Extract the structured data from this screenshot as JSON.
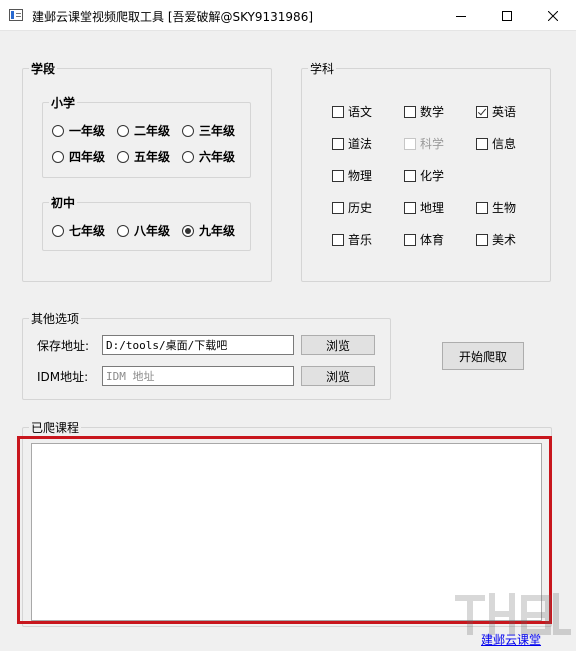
{
  "window": {
    "title": "建邺云课堂视频爬取工具 [吾爱破解@SKY9131986]",
    "controls": {
      "minimize": "minimize-icon",
      "maximize": "maximize-icon",
      "close": "close-icon"
    }
  },
  "stage_group": {
    "title": "学段",
    "primary": {
      "title": "小学",
      "options": [
        "一年级",
        "二年级",
        "三年级",
        "四年级",
        "五年级",
        "六年级"
      ]
    },
    "junior": {
      "title": "初中",
      "options": [
        "七年级",
        "八年级",
        "九年级"
      ],
      "selected": "九年级"
    }
  },
  "subject_group": {
    "title": "学科",
    "items": [
      {
        "label": "语文",
        "checked": false,
        "enabled": true
      },
      {
        "label": "数学",
        "checked": false,
        "enabled": true
      },
      {
        "label": "英语",
        "checked": true,
        "enabled": true
      },
      {
        "label": "道法",
        "checked": false,
        "enabled": true
      },
      {
        "label": "科学",
        "checked": false,
        "enabled": false
      },
      {
        "label": "信息",
        "checked": false,
        "enabled": true
      },
      {
        "label": "物理",
        "checked": false,
        "enabled": true
      },
      {
        "label": "化学",
        "checked": false,
        "enabled": true
      },
      {
        "label": "历史",
        "checked": false,
        "enabled": true
      },
      {
        "label": "地理",
        "checked": false,
        "enabled": true
      },
      {
        "label": "生物",
        "checked": false,
        "enabled": true
      },
      {
        "label": "音乐",
        "checked": false,
        "enabled": true
      },
      {
        "label": "体育",
        "checked": false,
        "enabled": true
      },
      {
        "label": "美术",
        "checked": false,
        "enabled": true
      }
    ]
  },
  "other_group": {
    "title": "其他选项",
    "save_label": "保存地址:",
    "save_value": "D:/tools/桌面/下载吧",
    "idm_label": "IDM地址:",
    "idm_placeholder": "IDM 地址",
    "browse_label": "浏览"
  },
  "start_button": "开始爬取",
  "crawled_group": {
    "title": "已爬课程",
    "content": ""
  },
  "footer_link": "建邺云课堂",
  "colors": {
    "highlight_border": "#c8161d",
    "link": "#0000ee"
  }
}
